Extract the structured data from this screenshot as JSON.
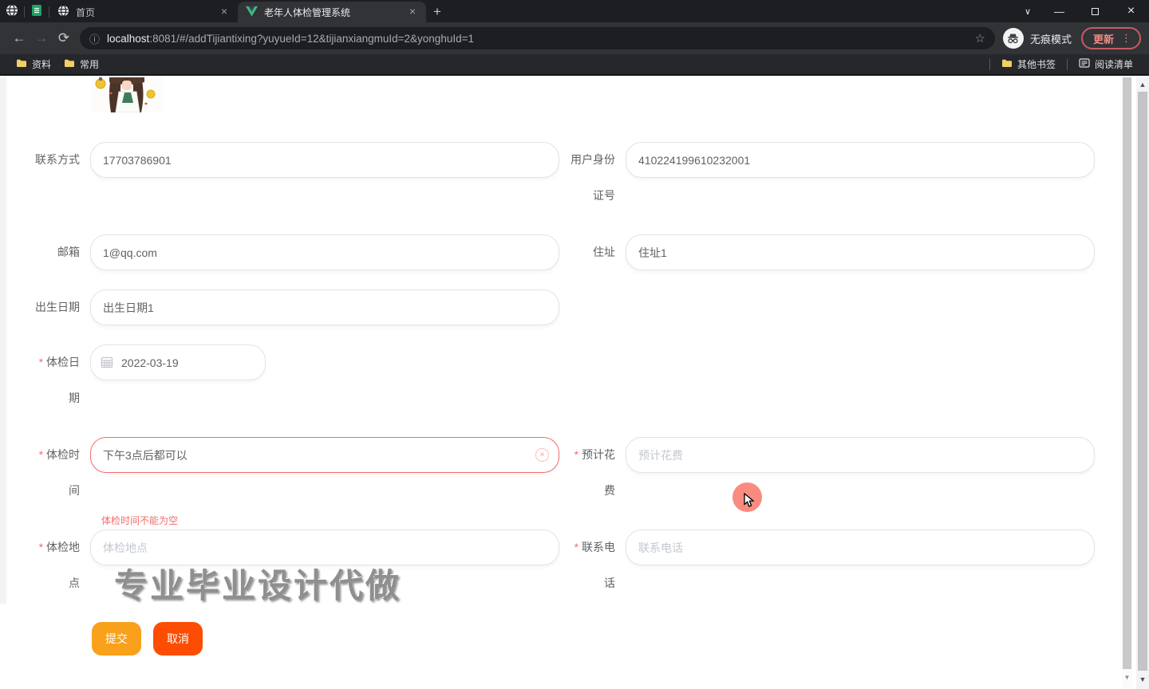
{
  "browser": {
    "tab_home": "首页",
    "tab_active": "老年人体检管理系统",
    "url_host": "localhost",
    "url_rest": ":8081/#/addTijiantixing?yuyueId=12&tijianxiangmuId=2&yonghuId=1",
    "incognito_label": "无痕模式",
    "update_label": "更新",
    "bookmarks": [
      "资料",
      "常用"
    ],
    "other_bookmarks": "其他书签",
    "reading_list": "阅读清单"
  },
  "form": {
    "contact": {
      "label": "联系方式",
      "value": "17703786901"
    },
    "id_card": {
      "label": "用户身份证号",
      "value": "410224199610232001"
    },
    "email": {
      "label": "邮箱",
      "value": "1@qq.com"
    },
    "address": {
      "label": "住址",
      "value": "住址1"
    },
    "birth_date": {
      "label": "出生日期",
      "value": "出生日期1"
    },
    "check_date": {
      "label": "体检日期",
      "value": "2022-03-19"
    },
    "check_time": {
      "label": "体检时间",
      "value": "下午3点后都可以",
      "error": "体检时间不能为空"
    },
    "cost": {
      "label": "预计花费",
      "placeholder": "预计花费"
    },
    "place": {
      "label": "体检地点",
      "placeholder": "体检地点"
    },
    "phone": {
      "label": "联系电话",
      "placeholder": "联系电话"
    },
    "submit_label": "提交",
    "cancel_label": "取消"
  },
  "watermark": "专业毕业设计代做",
  "icons": {
    "close": "×",
    "plus": "+",
    "tab_chevron": "∨",
    "minimize": "—",
    "back": "←",
    "forward": "→",
    "reload": "⟳",
    "info": "ⓘ",
    "star": "☆",
    "more_dots": "⋮",
    "clear": "×",
    "arrow_up": "▲",
    "arrow_down": "▼"
  },
  "colors": {
    "error": "#f56c6c",
    "submit_button": "#f9a11b",
    "cancel_button": "#fd4d03",
    "update_accent": "#f28b82",
    "active_tab_green": "#41b883"
  }
}
